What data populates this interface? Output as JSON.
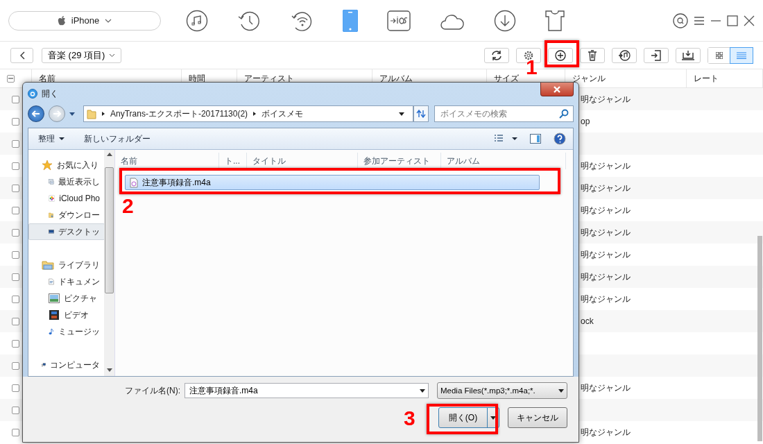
{
  "device_selector": {
    "label": "iPhone"
  },
  "nav_icons": [
    {
      "selected": false
    },
    {
      "selected": false
    },
    {
      "selected": false
    },
    {
      "selected": true
    },
    {
      "selected": false
    },
    {
      "selected": false
    },
    {
      "selected": false
    },
    {
      "selected": false
    }
  ],
  "category": {
    "label": "音楽 (29 項目)"
  },
  "view_toggle": [
    {
      "selected": false
    },
    {
      "selected": true
    }
  ],
  "table": {
    "select_all": {
      "indeterminate": true
    },
    "columns": [
      "名前",
      "時間",
      "アーティスト",
      "アルバム",
      "サイズ",
      "ジャンル",
      "レート"
    ],
    "rows": [
      {
        "checked": false,
        "genre": "明なジャンル"
      },
      {
        "checked": false,
        "genre": "op"
      },
      {
        "checked": false
      },
      {
        "checked": false,
        "genre": "明なジャンル"
      },
      {
        "checked": false,
        "genre": "明なジャンル"
      },
      {
        "checked": false,
        "genre": "明なジャンル"
      },
      {
        "checked": false,
        "genre": "明なジャンル"
      },
      {
        "checked": false,
        "genre": "明なジャンル"
      },
      {
        "checked": false,
        "genre": "明なジャンル"
      },
      {
        "checked": false,
        "genre": "明なジャンル"
      },
      {
        "checked": false,
        "genre": "ock"
      },
      {
        "checked": false
      },
      {
        "checked": false
      },
      {
        "checked": false,
        "genre": "明なジャンル"
      },
      {
        "checked": false
      },
      {
        "checked": false,
        "genre": "明なジャンル"
      }
    ]
  },
  "dialog": {
    "title": "開く",
    "address": [
      "AnyTrans-エクスポート-20171130(2)",
      "ボイスメモ"
    ],
    "search": {
      "placeholder": "ボイスメモの検索"
    },
    "commands": [
      {
        "label": "整理",
        "menu": true
      },
      {
        "label": "新しいフォルダー",
        "menu": false
      }
    ],
    "nav": [
      {
        "label": "お気に入り",
        "kind": "star",
        "selected": false,
        "children": [
          {
            "label": "最近表示し",
            "kind": "recent",
            "selected": false
          },
          {
            "label": "iCloud Pho",
            "kind": "photos",
            "selected": false
          },
          {
            "label": "ダウンロー",
            "kind": "download",
            "selected": false
          },
          {
            "label": "デスクトッ",
            "kind": "desktop",
            "selected": true
          }
        ]
      },
      {
        "label": "ライブラリ",
        "kind": "library",
        "selected": false,
        "children": [
          {
            "label": "ドキュメン",
            "kind": "document",
            "selected": false
          },
          {
            "label": "ピクチャ",
            "kind": "picture",
            "selected": false
          },
          {
            "label": "ビデオ",
            "kind": "video",
            "selected": false
          },
          {
            "label": "ミュージッ",
            "kind": "music",
            "selected": false
          }
        ]
      },
      {
        "label": "コンピュータ",
        "kind": "computer",
        "selected": false
      }
    ],
    "columns": [
      "名前",
      "ト...",
      "タイトル",
      "参加アーティスト",
      "アルバム"
    ],
    "files": [
      {
        "name": "注意事項録音.m4a",
        "selected": true
      }
    ],
    "filename_label": "ファイル名(N):",
    "filename_value": "注意事項録音.m4a",
    "filter": "Media Files(*.mp3;*.m4a;*.",
    "buttons": [
      {
        "label": "開く(O)",
        "kind": "split"
      },
      {
        "label": "キャンセル",
        "kind": "plain"
      }
    ]
  },
  "annotations": [
    {
      "label": "1"
    },
    {
      "label": "2"
    },
    {
      "label": "3"
    }
  ]
}
